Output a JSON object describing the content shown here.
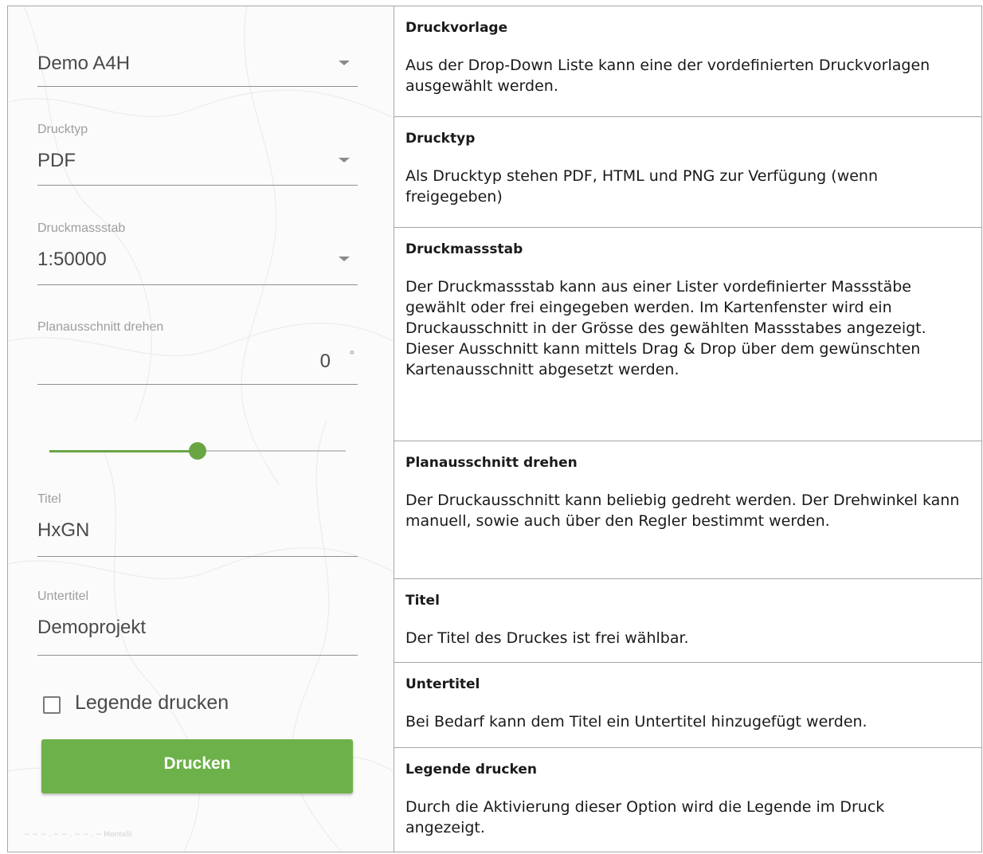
{
  "panel": {
    "template": {
      "value": "Demo A4H"
    },
    "print_type": {
      "label": "Drucktyp",
      "value": "PDF"
    },
    "scale": {
      "label": "Druckmassstab",
      "value": "1:50000"
    },
    "rotation": {
      "label": "Planausschnitt drehen",
      "value": "0",
      "unit": "°"
    },
    "rotation_slider": {
      "position_fraction": 0.5
    },
    "title_field": {
      "label": "Titel",
      "value": "HxGN"
    },
    "subtitle_field": {
      "label": "Untertitel",
      "value": "Demoprojekt"
    },
    "legend_checkbox": {
      "label": "Legende drucken",
      "checked": false
    },
    "print_button": {
      "label": "Drucken"
    },
    "colors": {
      "accent": "#6db14a",
      "slider": "#6aa544"
    }
  },
  "descriptions": [
    {
      "title": "Druckvorlage",
      "text": "Aus der Drop-Down Liste kann eine der vordefinierten Druckvorlagen ausgewählt werden."
    },
    {
      "title": "Drucktyp",
      "text": "Als Drucktyp stehen PDF, HTML und PNG zur Verfügung (wenn freigegeben)"
    },
    {
      "title": "Druckmassstab",
      "text": "Der Druckmassstab kann aus einer Lister vordefinierter Massstäbe gewählt oder frei eingegeben werden. Im Kartenfenster wird ein Druckausschnitt in der Grösse des gewählten Massstabes angezeigt. Dieser Ausschnitt kann mittels Drag & Drop über dem gewünschten Kartenausschnitt abgesetzt werden."
    },
    {
      "title": "Planausschnitt drehen",
      "text": "Der Druckausschnitt kann beliebig gedreht werden. Der Drehwinkel kann manuell, sowie auch über den Regler bestimmt werden."
    },
    {
      "title": "Titel",
      "text": "Der Titel des Druckes ist frei wählbar."
    },
    {
      "title": "Untertitel",
      "text": "Bei Bedarf kann dem Titel ein Untertitel hinzugefügt werden."
    },
    {
      "title": "Legende drucken",
      "text": "Durch die Aktivierung dieser Option wird die Legende im Druck angezeigt."
    }
  ]
}
